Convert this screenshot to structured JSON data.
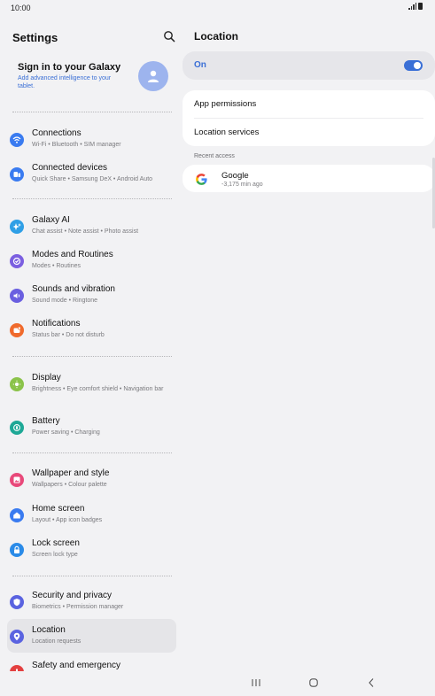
{
  "status": {
    "time": "10:00"
  },
  "settings": {
    "title": "Settings",
    "account": {
      "title": "Sign in to your Galaxy",
      "subtitle": "Add advanced intelligence to your tablet."
    },
    "items": [
      {
        "title": "Connections",
        "sub": "Wi-Fi • Bluetooth • SIM manager",
        "icon": "wifi-icon",
        "color": "#3a7bf0"
      },
      {
        "title": "Connected devices",
        "sub": "Quick Share • Samsung DeX • Android Auto",
        "icon": "devices-icon",
        "color": "#3a7bf0"
      },
      {
        "title": "Galaxy AI",
        "sub": "Chat assist • Note assist • Photo assist",
        "icon": "sparkle-icon",
        "color": "#2f9fe6"
      },
      {
        "title": "Modes and Routines",
        "sub": "Modes • Routines",
        "icon": "modes-icon",
        "color": "#7b5fe0"
      },
      {
        "title": "Sounds and vibration",
        "sub": "Sound mode • Ringtone",
        "icon": "speaker-icon",
        "color": "#6a5fe0"
      },
      {
        "title": "Notifications",
        "sub": "Status bar • Do not disturb",
        "icon": "bell-icon",
        "color": "#f06a2c"
      },
      {
        "title": "Display",
        "sub": "Brightness • Eye comfort shield • Navigation bar",
        "icon": "sun-icon",
        "color": "#8bc34a"
      },
      {
        "title": "Battery",
        "sub": "Power saving • Charging",
        "icon": "battery-icon",
        "color": "#1ea896"
      },
      {
        "title": "Wallpaper and style",
        "sub": "Wallpapers • Colour palette",
        "icon": "wallpaper-icon",
        "color": "#e8497a"
      },
      {
        "title": "Home screen",
        "sub": "Layout • App icon badges",
        "icon": "home-icon",
        "color": "#3a7bf0"
      },
      {
        "title": "Lock screen",
        "sub": "Screen lock type",
        "icon": "lock-icon",
        "color": "#2a8be8"
      },
      {
        "title": "Security and privacy",
        "sub": "Biometrics • Permission manager",
        "icon": "shield-icon",
        "color": "#5a63e0"
      },
      {
        "title": "Location",
        "sub": "Location requests",
        "icon": "location-pin-icon",
        "color": "#5a63e0"
      },
      {
        "title": "Safety and emergency",
        "sub": "",
        "icon": "emergency-icon",
        "color": "#e34040"
      }
    ]
  },
  "location": {
    "title": "Location",
    "toggle_label": "On",
    "toggle_on": true,
    "menu": [
      "App permissions",
      "Location services"
    ],
    "recent_label": "Recent access",
    "recent": [
      {
        "name": "Google",
        "time": "-3,175 min ago"
      }
    ]
  },
  "colors": {
    "accent": "#3a6fd6",
    "background": "#f2f2f4",
    "card": "#ffffff"
  }
}
